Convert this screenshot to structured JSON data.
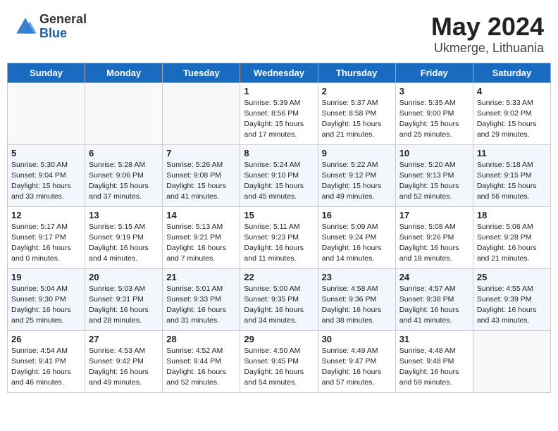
{
  "header": {
    "logo_general": "General",
    "logo_blue": "Blue",
    "title": "May 2024",
    "subtitle": "Ukmerge, Lithuania"
  },
  "days_of_week": [
    "Sunday",
    "Monday",
    "Tuesday",
    "Wednesday",
    "Thursday",
    "Friday",
    "Saturday"
  ],
  "weeks": [
    [
      {
        "day": "",
        "info": ""
      },
      {
        "day": "",
        "info": ""
      },
      {
        "day": "",
        "info": ""
      },
      {
        "day": "1",
        "info": "Sunrise: 5:39 AM\nSunset: 8:56 PM\nDaylight: 15 hours\nand 17 minutes."
      },
      {
        "day": "2",
        "info": "Sunrise: 5:37 AM\nSunset: 8:58 PM\nDaylight: 15 hours\nand 21 minutes."
      },
      {
        "day": "3",
        "info": "Sunrise: 5:35 AM\nSunset: 9:00 PM\nDaylight: 15 hours\nand 25 minutes."
      },
      {
        "day": "4",
        "info": "Sunrise: 5:33 AM\nSunset: 9:02 PM\nDaylight: 15 hours\nand 29 minutes."
      }
    ],
    [
      {
        "day": "5",
        "info": "Sunrise: 5:30 AM\nSunset: 9:04 PM\nDaylight: 15 hours\nand 33 minutes."
      },
      {
        "day": "6",
        "info": "Sunrise: 5:28 AM\nSunset: 9:06 PM\nDaylight: 15 hours\nand 37 minutes."
      },
      {
        "day": "7",
        "info": "Sunrise: 5:26 AM\nSunset: 9:08 PM\nDaylight: 15 hours\nand 41 minutes."
      },
      {
        "day": "8",
        "info": "Sunrise: 5:24 AM\nSunset: 9:10 PM\nDaylight: 15 hours\nand 45 minutes."
      },
      {
        "day": "9",
        "info": "Sunrise: 5:22 AM\nSunset: 9:12 PM\nDaylight: 15 hours\nand 49 minutes."
      },
      {
        "day": "10",
        "info": "Sunrise: 5:20 AM\nSunset: 9:13 PM\nDaylight: 15 hours\nand 52 minutes."
      },
      {
        "day": "11",
        "info": "Sunrise: 5:18 AM\nSunset: 9:15 PM\nDaylight: 15 hours\nand 56 minutes."
      }
    ],
    [
      {
        "day": "12",
        "info": "Sunrise: 5:17 AM\nSunset: 9:17 PM\nDaylight: 16 hours\nand 0 minutes."
      },
      {
        "day": "13",
        "info": "Sunrise: 5:15 AM\nSunset: 9:19 PM\nDaylight: 16 hours\nand 4 minutes."
      },
      {
        "day": "14",
        "info": "Sunrise: 5:13 AM\nSunset: 9:21 PM\nDaylight: 16 hours\nand 7 minutes."
      },
      {
        "day": "15",
        "info": "Sunrise: 5:11 AM\nSunset: 9:23 PM\nDaylight: 16 hours\nand 11 minutes."
      },
      {
        "day": "16",
        "info": "Sunrise: 5:09 AM\nSunset: 9:24 PM\nDaylight: 16 hours\nand 14 minutes."
      },
      {
        "day": "17",
        "info": "Sunrise: 5:08 AM\nSunset: 9:26 PM\nDaylight: 16 hours\nand 18 minutes."
      },
      {
        "day": "18",
        "info": "Sunrise: 5:06 AM\nSunset: 9:28 PM\nDaylight: 16 hours\nand 21 minutes."
      }
    ],
    [
      {
        "day": "19",
        "info": "Sunrise: 5:04 AM\nSunset: 9:30 PM\nDaylight: 16 hours\nand 25 minutes."
      },
      {
        "day": "20",
        "info": "Sunrise: 5:03 AM\nSunset: 9:31 PM\nDaylight: 16 hours\nand 28 minutes."
      },
      {
        "day": "21",
        "info": "Sunrise: 5:01 AM\nSunset: 9:33 PM\nDaylight: 16 hours\nand 31 minutes."
      },
      {
        "day": "22",
        "info": "Sunrise: 5:00 AM\nSunset: 9:35 PM\nDaylight: 16 hours\nand 34 minutes."
      },
      {
        "day": "23",
        "info": "Sunrise: 4:58 AM\nSunset: 9:36 PM\nDaylight: 16 hours\nand 38 minutes."
      },
      {
        "day": "24",
        "info": "Sunrise: 4:57 AM\nSunset: 9:38 PM\nDaylight: 16 hours\nand 41 minutes."
      },
      {
        "day": "25",
        "info": "Sunrise: 4:55 AM\nSunset: 9:39 PM\nDaylight: 16 hours\nand 43 minutes."
      }
    ],
    [
      {
        "day": "26",
        "info": "Sunrise: 4:54 AM\nSunset: 9:41 PM\nDaylight: 16 hours\nand 46 minutes."
      },
      {
        "day": "27",
        "info": "Sunrise: 4:53 AM\nSunset: 9:42 PM\nDaylight: 16 hours\nand 49 minutes."
      },
      {
        "day": "28",
        "info": "Sunrise: 4:52 AM\nSunset: 9:44 PM\nDaylight: 16 hours\nand 52 minutes."
      },
      {
        "day": "29",
        "info": "Sunrise: 4:50 AM\nSunset: 9:45 PM\nDaylight: 16 hours\nand 54 minutes."
      },
      {
        "day": "30",
        "info": "Sunrise: 4:49 AM\nSunset: 9:47 PM\nDaylight: 16 hours\nand 57 minutes."
      },
      {
        "day": "31",
        "info": "Sunrise: 4:48 AM\nSunset: 9:48 PM\nDaylight: 16 hours\nand 59 minutes."
      },
      {
        "day": "",
        "info": ""
      }
    ]
  ]
}
